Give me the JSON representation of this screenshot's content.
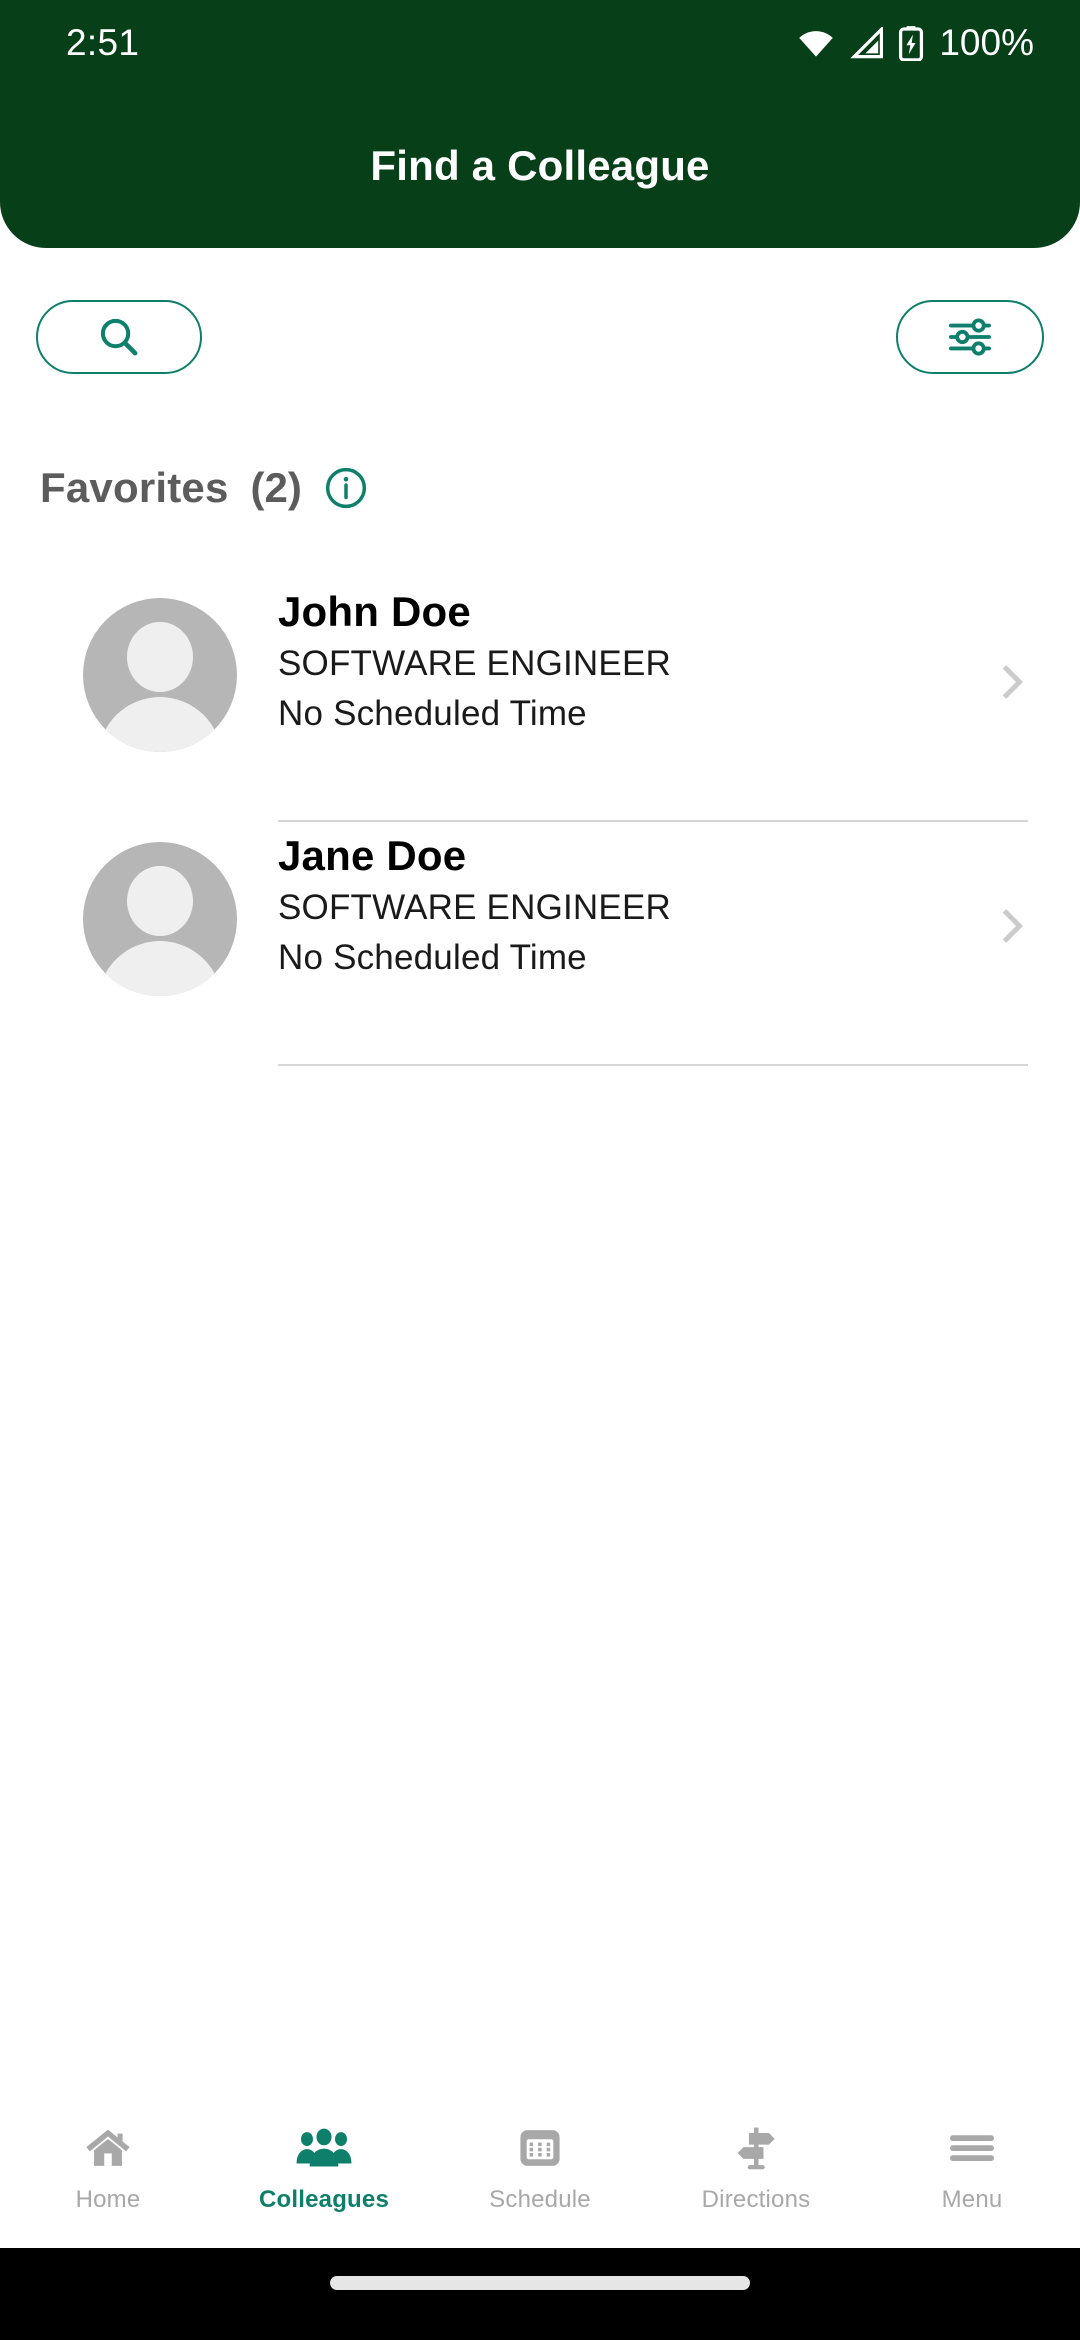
{
  "status_bar": {
    "time": "2:51",
    "battery_percent": "100%",
    "wifi_icon": "wifi-icon",
    "signal_icon": "cellular-signal-icon",
    "battery_icon": "battery-charging-icon"
  },
  "header": {
    "title": "Find a Colleague",
    "background_color": "#073f19"
  },
  "toolbar": {
    "search_icon": "search-icon",
    "filter_icon": "filter-sliders-icon",
    "accent_color": "#0d7f6b"
  },
  "section": {
    "title": "Favorites",
    "count": "(2)",
    "info_icon": "info-circle-icon"
  },
  "colleagues": [
    {
      "name": "John Doe",
      "role": "SOFTWARE ENGINEER",
      "schedule": "No Scheduled Time",
      "avatar_icon": "person-placeholder-avatar",
      "chevron_icon": "chevron-right-icon"
    },
    {
      "name": "Jane Doe",
      "role": "SOFTWARE ENGINEER",
      "schedule": "No Scheduled Time",
      "avatar_icon": "person-placeholder-avatar",
      "chevron_icon": "chevron-right-icon"
    }
  ],
  "bottom_nav": {
    "active_index": 1,
    "active_color": "#0d7f6b",
    "inactive_color": "#a8a8a8",
    "items": [
      {
        "label": "Home",
        "icon": "home-icon"
      },
      {
        "label": "Colleagues",
        "icon": "people-group-icon"
      },
      {
        "label": "Schedule",
        "icon": "calendar-icon"
      },
      {
        "label": "Directions",
        "icon": "signpost-icon"
      },
      {
        "label": "Menu",
        "icon": "hamburger-menu-icon"
      }
    ]
  },
  "gesture_bar": {
    "handle": "home-gesture-handle"
  }
}
